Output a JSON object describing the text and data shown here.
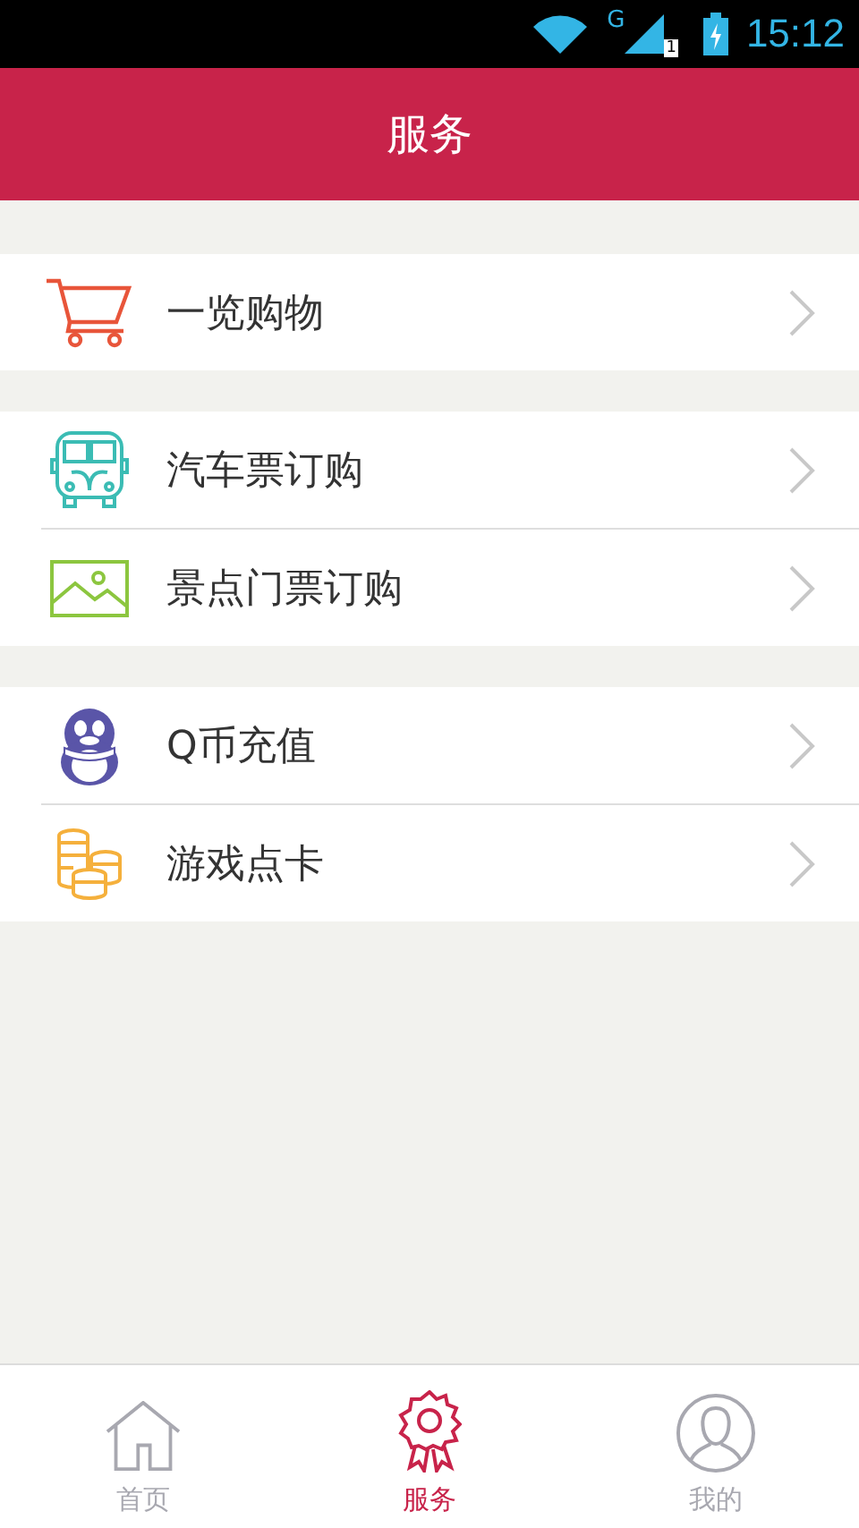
{
  "status_bar": {
    "network": "G",
    "sim": "1",
    "time": "15:12"
  },
  "header": {
    "title": "服务"
  },
  "groups": [
    {
      "items": [
        {
          "kind": "cart",
          "label": "一览购物"
        }
      ]
    },
    {
      "items": [
        {
          "kind": "bus",
          "label": "汽车票订购"
        },
        {
          "kind": "scenery",
          "label": "景点门票订购"
        }
      ]
    },
    {
      "items": [
        {
          "kind": "penguin",
          "label": "Q币充值"
        },
        {
          "kind": "coins",
          "label": "游戏点卡"
        }
      ]
    }
  ],
  "tabs": [
    {
      "kind": "home",
      "label": "首页",
      "selected": false
    },
    {
      "kind": "ribbon",
      "label": "服务",
      "selected": true
    },
    {
      "kind": "user",
      "label": "我的",
      "selected": false
    }
  ]
}
